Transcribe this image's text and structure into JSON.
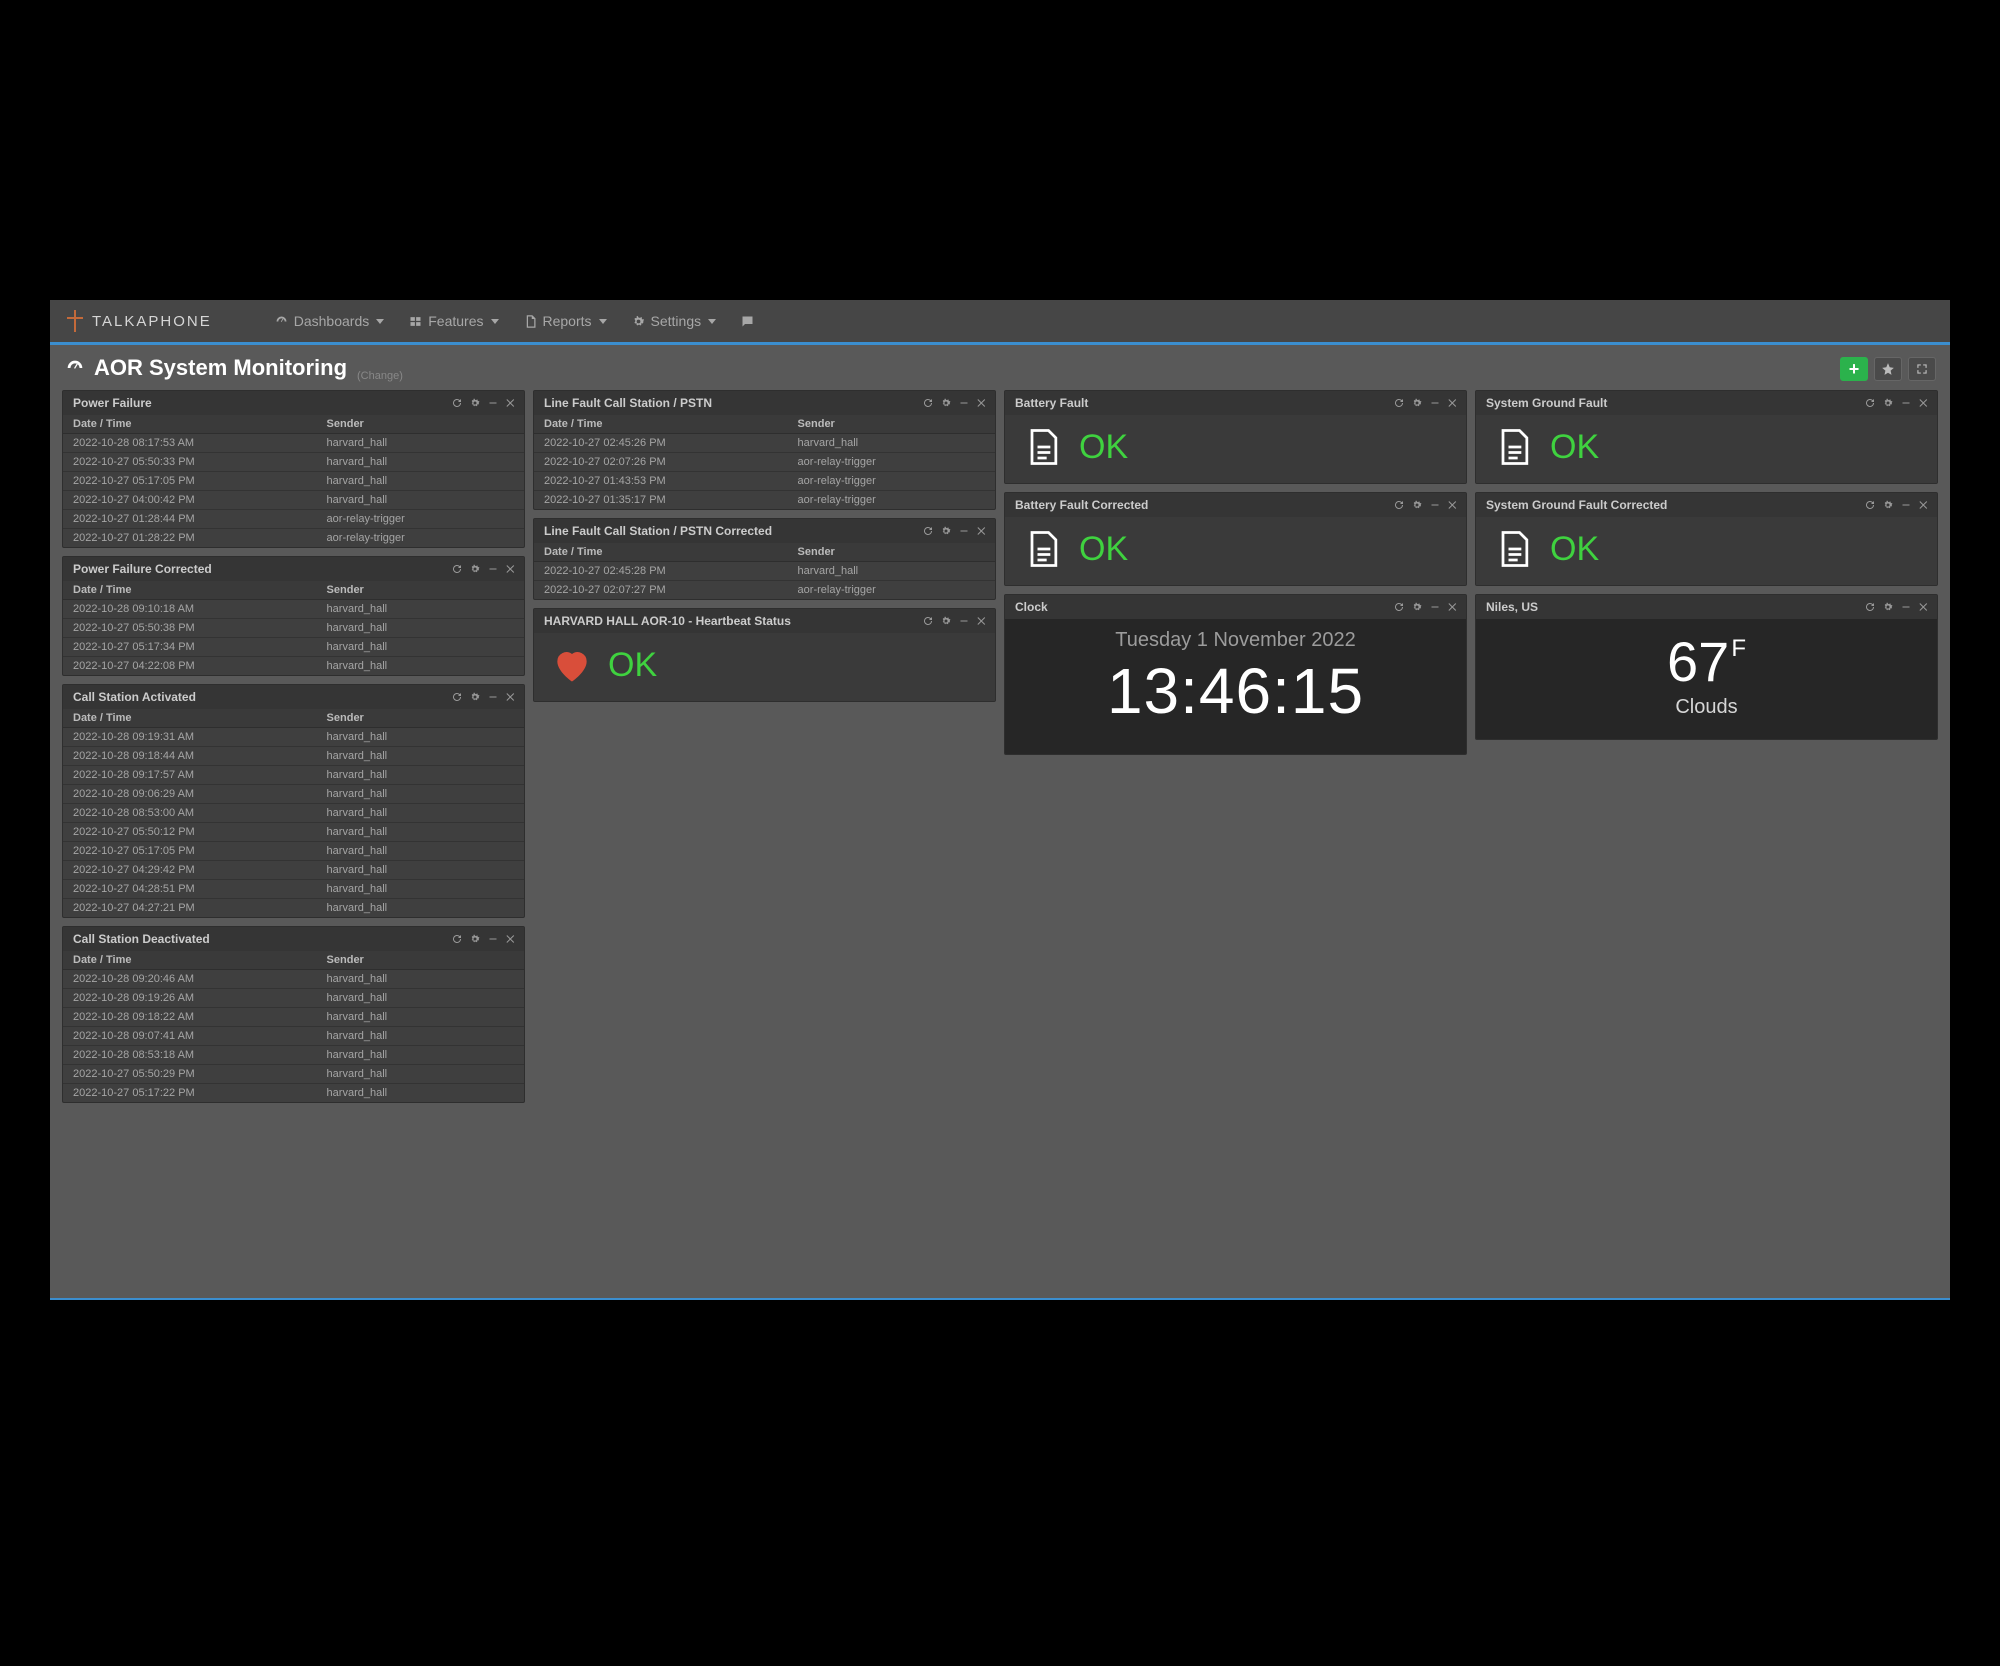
{
  "brand": {
    "name": "TALKAPHONE"
  },
  "nav": {
    "dashboards": "Dashboards",
    "features": "Features",
    "reports": "Reports",
    "settings": "Settings"
  },
  "page": {
    "title": "AOR System Monitoring",
    "change_label": "(Change)"
  },
  "columns": {
    "date_time": "Date / Time",
    "sender": "Sender"
  },
  "status": {
    "ok": "OK"
  },
  "panels": {
    "power_failure": {
      "title": "Power Failure",
      "rows": [
        {
          "dt": "2022-10-28 08:17:53 AM",
          "sender": "harvard_hall"
        },
        {
          "dt": "2022-10-27 05:50:33 PM",
          "sender": "harvard_hall"
        },
        {
          "dt": "2022-10-27 05:17:05 PM",
          "sender": "harvard_hall"
        },
        {
          "dt": "2022-10-27 04:00:42 PM",
          "sender": "harvard_hall"
        },
        {
          "dt": "2022-10-27 01:28:44 PM",
          "sender": "aor-relay-trigger"
        },
        {
          "dt": "2022-10-27 01:28:22 PM",
          "sender": "aor-relay-trigger"
        }
      ]
    },
    "power_failure_corrected": {
      "title": "Power Failure Corrected",
      "rows": [
        {
          "dt": "2022-10-28 09:10:18 AM",
          "sender": "harvard_hall"
        },
        {
          "dt": "2022-10-27 05:50:38 PM",
          "sender": "harvard_hall"
        },
        {
          "dt": "2022-10-27 05:17:34 PM",
          "sender": "harvard_hall"
        },
        {
          "dt": "2022-10-27 04:22:08 PM",
          "sender": "harvard_hall"
        }
      ]
    },
    "call_station_activated": {
      "title": "Call Station Activated",
      "rows": [
        {
          "dt": "2022-10-28 09:19:31 AM",
          "sender": "harvard_hall"
        },
        {
          "dt": "2022-10-28 09:18:44 AM",
          "sender": "harvard_hall"
        },
        {
          "dt": "2022-10-28 09:17:57 AM",
          "sender": "harvard_hall"
        },
        {
          "dt": "2022-10-28 09:06:29 AM",
          "sender": "harvard_hall"
        },
        {
          "dt": "2022-10-28 08:53:00 AM",
          "sender": "harvard_hall"
        },
        {
          "dt": "2022-10-27 05:50:12 PM",
          "sender": "harvard_hall"
        },
        {
          "dt": "2022-10-27 05:17:05 PM",
          "sender": "harvard_hall"
        },
        {
          "dt": "2022-10-27 04:29:42 PM",
          "sender": "harvard_hall"
        },
        {
          "dt": "2022-10-27 04:28:51 PM",
          "sender": "harvard_hall"
        },
        {
          "dt": "2022-10-27 04:27:21 PM",
          "sender": "harvard_hall"
        }
      ]
    },
    "call_station_deactivated": {
      "title": "Call Station Deactivated",
      "rows": [
        {
          "dt": "2022-10-28 09:20:46 AM",
          "sender": "harvard_hall"
        },
        {
          "dt": "2022-10-28 09:19:26 AM",
          "sender": "harvard_hall"
        },
        {
          "dt": "2022-10-28 09:18:22 AM",
          "sender": "harvard_hall"
        },
        {
          "dt": "2022-10-28 09:07:41 AM",
          "sender": "harvard_hall"
        },
        {
          "dt": "2022-10-28 08:53:18 AM",
          "sender": "harvard_hall"
        },
        {
          "dt": "2022-10-27 05:50:29 PM",
          "sender": "harvard_hall"
        },
        {
          "dt": "2022-10-27 05:17:22 PM",
          "sender": "harvard_hall"
        }
      ]
    },
    "line_fault": {
      "title": "Line Fault Call Station / PSTN",
      "rows": [
        {
          "dt": "2022-10-27 02:45:26 PM",
          "sender": "harvard_hall"
        },
        {
          "dt": "2022-10-27 02:07:26 PM",
          "sender": "aor-relay-trigger"
        },
        {
          "dt": "2022-10-27 01:43:53 PM",
          "sender": "aor-relay-trigger"
        },
        {
          "dt": "2022-10-27 01:35:17 PM",
          "sender": "aor-relay-trigger"
        }
      ]
    },
    "line_fault_corrected": {
      "title": "Line Fault Call Station / PSTN Corrected",
      "rows": [
        {
          "dt": "2022-10-27 02:45:28 PM",
          "sender": "harvard_hall"
        },
        {
          "dt": "2022-10-27 02:07:27 PM",
          "sender": "aor-relay-trigger"
        }
      ]
    },
    "heartbeat": {
      "title": "HARVARD HALL AOR-10 - Heartbeat Status"
    },
    "battery_fault": {
      "title": "Battery Fault"
    },
    "battery_fault_corrected": {
      "title": "Battery Fault Corrected"
    },
    "ground_fault": {
      "title": "System Ground Fault"
    },
    "ground_fault_corrected": {
      "title": "System Ground Fault Corrected"
    },
    "clock": {
      "title": "Clock",
      "date": "Tuesday 1 November 2022",
      "time": "13:46:15"
    },
    "weather": {
      "title": "Niles, US",
      "temp": "67",
      "unit": "F",
      "condition": "Clouds"
    }
  }
}
